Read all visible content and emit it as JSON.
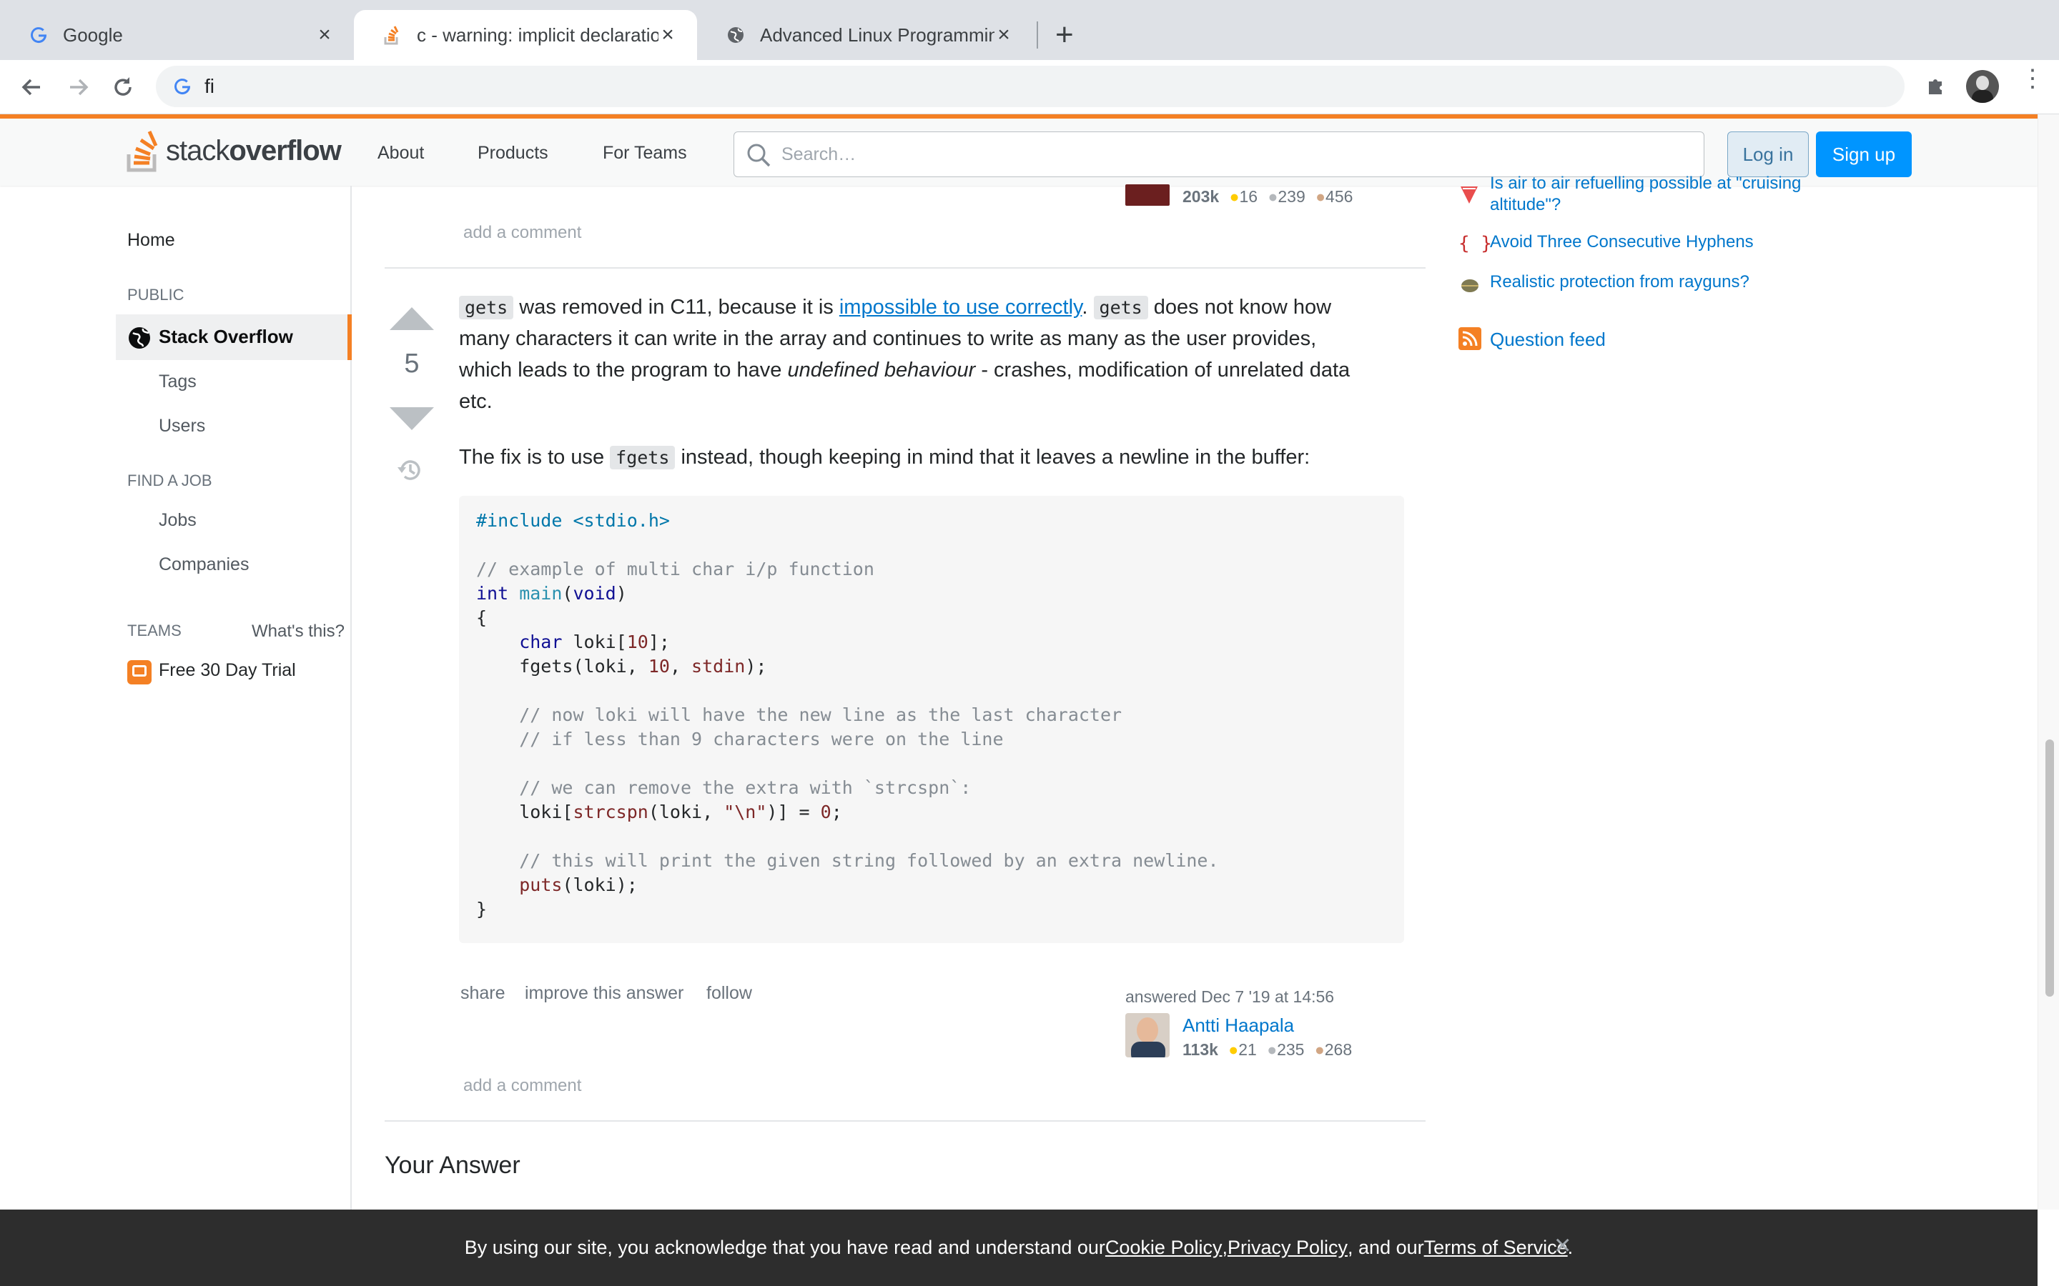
{
  "browser": {
    "tabs": [
      {
        "title": "Google",
        "icon": "google-icon"
      },
      {
        "title": "c - warning: implicit declaration of function 'gets'",
        "icon": "stackoverflow-icon"
      },
      {
        "title": "Advanced Linux Programming",
        "icon": "globe-icon"
      }
    ],
    "address": "fi"
  },
  "header": {
    "logo_a": "stack",
    "logo_b": "overflow",
    "nav": [
      "About",
      "Products",
      "For Teams"
    ],
    "search_placeholder": "Search…",
    "login": "Log in",
    "signup": "Sign up"
  },
  "leftnav": {
    "home": "Home",
    "public": "PUBLIC",
    "stackoverflow": "Stack Overflow",
    "tags": "Tags",
    "users": "Users",
    "findjob": "FIND A JOB",
    "jobs": "Jobs",
    "companies": "Companies",
    "teams": "TEAMS",
    "whats": "What's this?",
    "trial": "Free 30 Day Trial"
  },
  "prev_answer": {
    "rep": "203k",
    "gold": "16",
    "silver": "239",
    "bronze": "456",
    "add_comment": "add a comment"
  },
  "answer": {
    "votes": "5",
    "p1_code1": "gets",
    "p1_a": " was removed in C11, because it is ",
    "p1_link": "impossible to use correctly",
    "p1_b": ". ",
    "p1_code2": "gets",
    "p1_c": " does not know how",
    "p1_line2": "many characters it can write in the array and continues to write as many as the user provides,",
    "p1_line3a": "which leads to the program to have ",
    "p1_em": "undefined behaviour",
    "p1_line3b": " - crashes, modification of unrelated data",
    "p1_line4": "etc.",
    "p2_a": "The fix is to use ",
    "p2_code": "fgets",
    "p2_b": " instead, though keeping in mind that it leaves a newline in the buffer:",
    "code": {
      "l1": "#include <stdio.h>",
      "l2": "// example of multi char i/p function",
      "l3a": "int",
      "l3b": " main",
      "l3c": "(",
      "l3d": "void",
      "l3e": ")",
      "l4": "{",
      "l5a": "    char",
      "l5b": " loki[",
      "l5c": "10",
      "l5d": "];",
      "l6a": "    fgets(loki, ",
      "l6b": "10",
      "l6c": ", ",
      "l6d": "stdin",
      "l6e": ");",
      "l7": "    // now loki will have the new line as the last character",
      "l8": "    // if less than 9 characters were on the line",
      "l9": "    // we can remove the extra with `strcspn`:",
      "l10a": "    loki[",
      "l10b": "strcspn",
      "l10c": "(loki, ",
      "l10d": "\"\\n\"",
      "l10e": ")] = ",
      "l10f": "0",
      "l10g": ";",
      "l11": "    // this will print the given string followed by an extra newline.",
      "l12a": "    ",
      "l12b": "puts",
      "l12c": "(loki);",
      "l13": "}"
    },
    "share": "share",
    "improve": "improve this answer",
    "follow": "follow",
    "answered": "answered Dec 7 '19 at 14:56",
    "author": "Antti Haapala",
    "rep": "113k",
    "gold": "21",
    "silver": "235",
    "bronze": "268",
    "add_comment": "add a comment"
  },
  "your_answer": "Your Answer",
  "sidebar": {
    "q1": "Is air to air refuelling possible at \"cruising altitude\"?",
    "q2": "Avoid Three Consecutive Hyphens",
    "q3": "Realistic protection from rayguns?",
    "feed": "Question feed"
  },
  "cookie": {
    "a": "By using our site, you acknowledge that you have read and understand our ",
    "cookie_policy": "Cookie Policy",
    "comma": ", ",
    "privacy": "Privacy Policy",
    "and": ", and our ",
    "terms": "Terms of Service",
    "dot": "."
  },
  "colors": {
    "accent": "#f48024",
    "link": "#0077cc",
    "button": "#0095ff"
  }
}
